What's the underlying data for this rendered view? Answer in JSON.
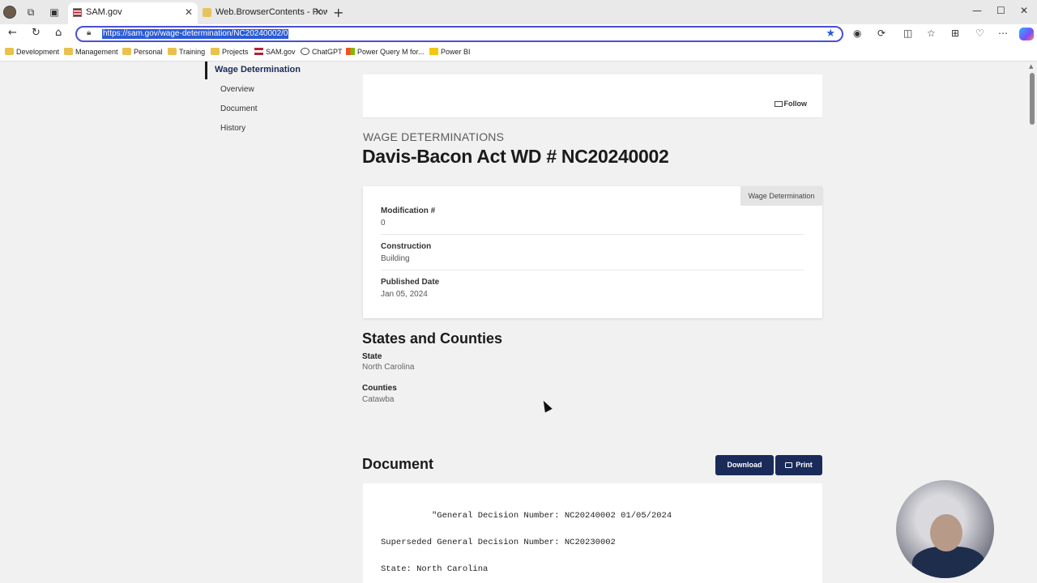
{
  "browser": {
    "tabs": [
      {
        "title": "SAM.gov",
        "active": true
      },
      {
        "title": "Web.BrowserContents - PowerQu",
        "active": false
      }
    ],
    "address": {
      "url": "https://sam.gov/wage-determination/NC20240002/0"
    },
    "bookmarks": [
      {
        "label": "Development",
        "icon": "folder-icon"
      },
      {
        "label": "Management",
        "icon": "folder-icon"
      },
      {
        "label": "Personal",
        "icon": "folder-icon"
      },
      {
        "label": "Training",
        "icon": "folder-icon"
      },
      {
        "label": "Projects",
        "icon": "folder-icon"
      },
      {
        "label": "SAM.gov",
        "icon": "sam-flag-icon"
      },
      {
        "label": "ChatGPT",
        "icon": "chatgpt-icon"
      },
      {
        "label": "Power Query M for...",
        "icon": "microsoft-icon"
      },
      {
        "label": "Power BI",
        "icon": "powerbi-icon"
      }
    ],
    "accent_color": "#4a4fd6"
  },
  "sidebar": {
    "title": "Wage Determination",
    "items": [
      {
        "label": "Overview"
      },
      {
        "label": "Document"
      },
      {
        "label": "History"
      }
    ]
  },
  "header": {
    "follow_label": "Follow",
    "kicker": "WAGE DETERMINATIONS",
    "title": "Davis-Bacon Act WD # NC20240002"
  },
  "info_card": {
    "badge": "Wage Determination",
    "fields": [
      {
        "label": "Modification #",
        "value": "0"
      },
      {
        "label": "Construction",
        "value": "Building"
      },
      {
        "label": "Published Date",
        "value": "Jan 05, 2024"
      }
    ]
  },
  "states_counties": {
    "heading": "States and Counties",
    "state_label": "State",
    "state_value": "North Carolina",
    "counties_label": "Counties",
    "counties_value": "Catawba"
  },
  "document": {
    "heading": "Document",
    "download_label": "Download",
    "print_label": "Print",
    "lines": [
      "\"General Decision Number: NC20240002 01/05/2024",
      "Superseded General Decision Number: NC20230002",
      "State: North Carolina"
    ]
  },
  "colors": {
    "primary_button": "#1a2b5a",
    "page_bg": "#f1f1f1"
  }
}
